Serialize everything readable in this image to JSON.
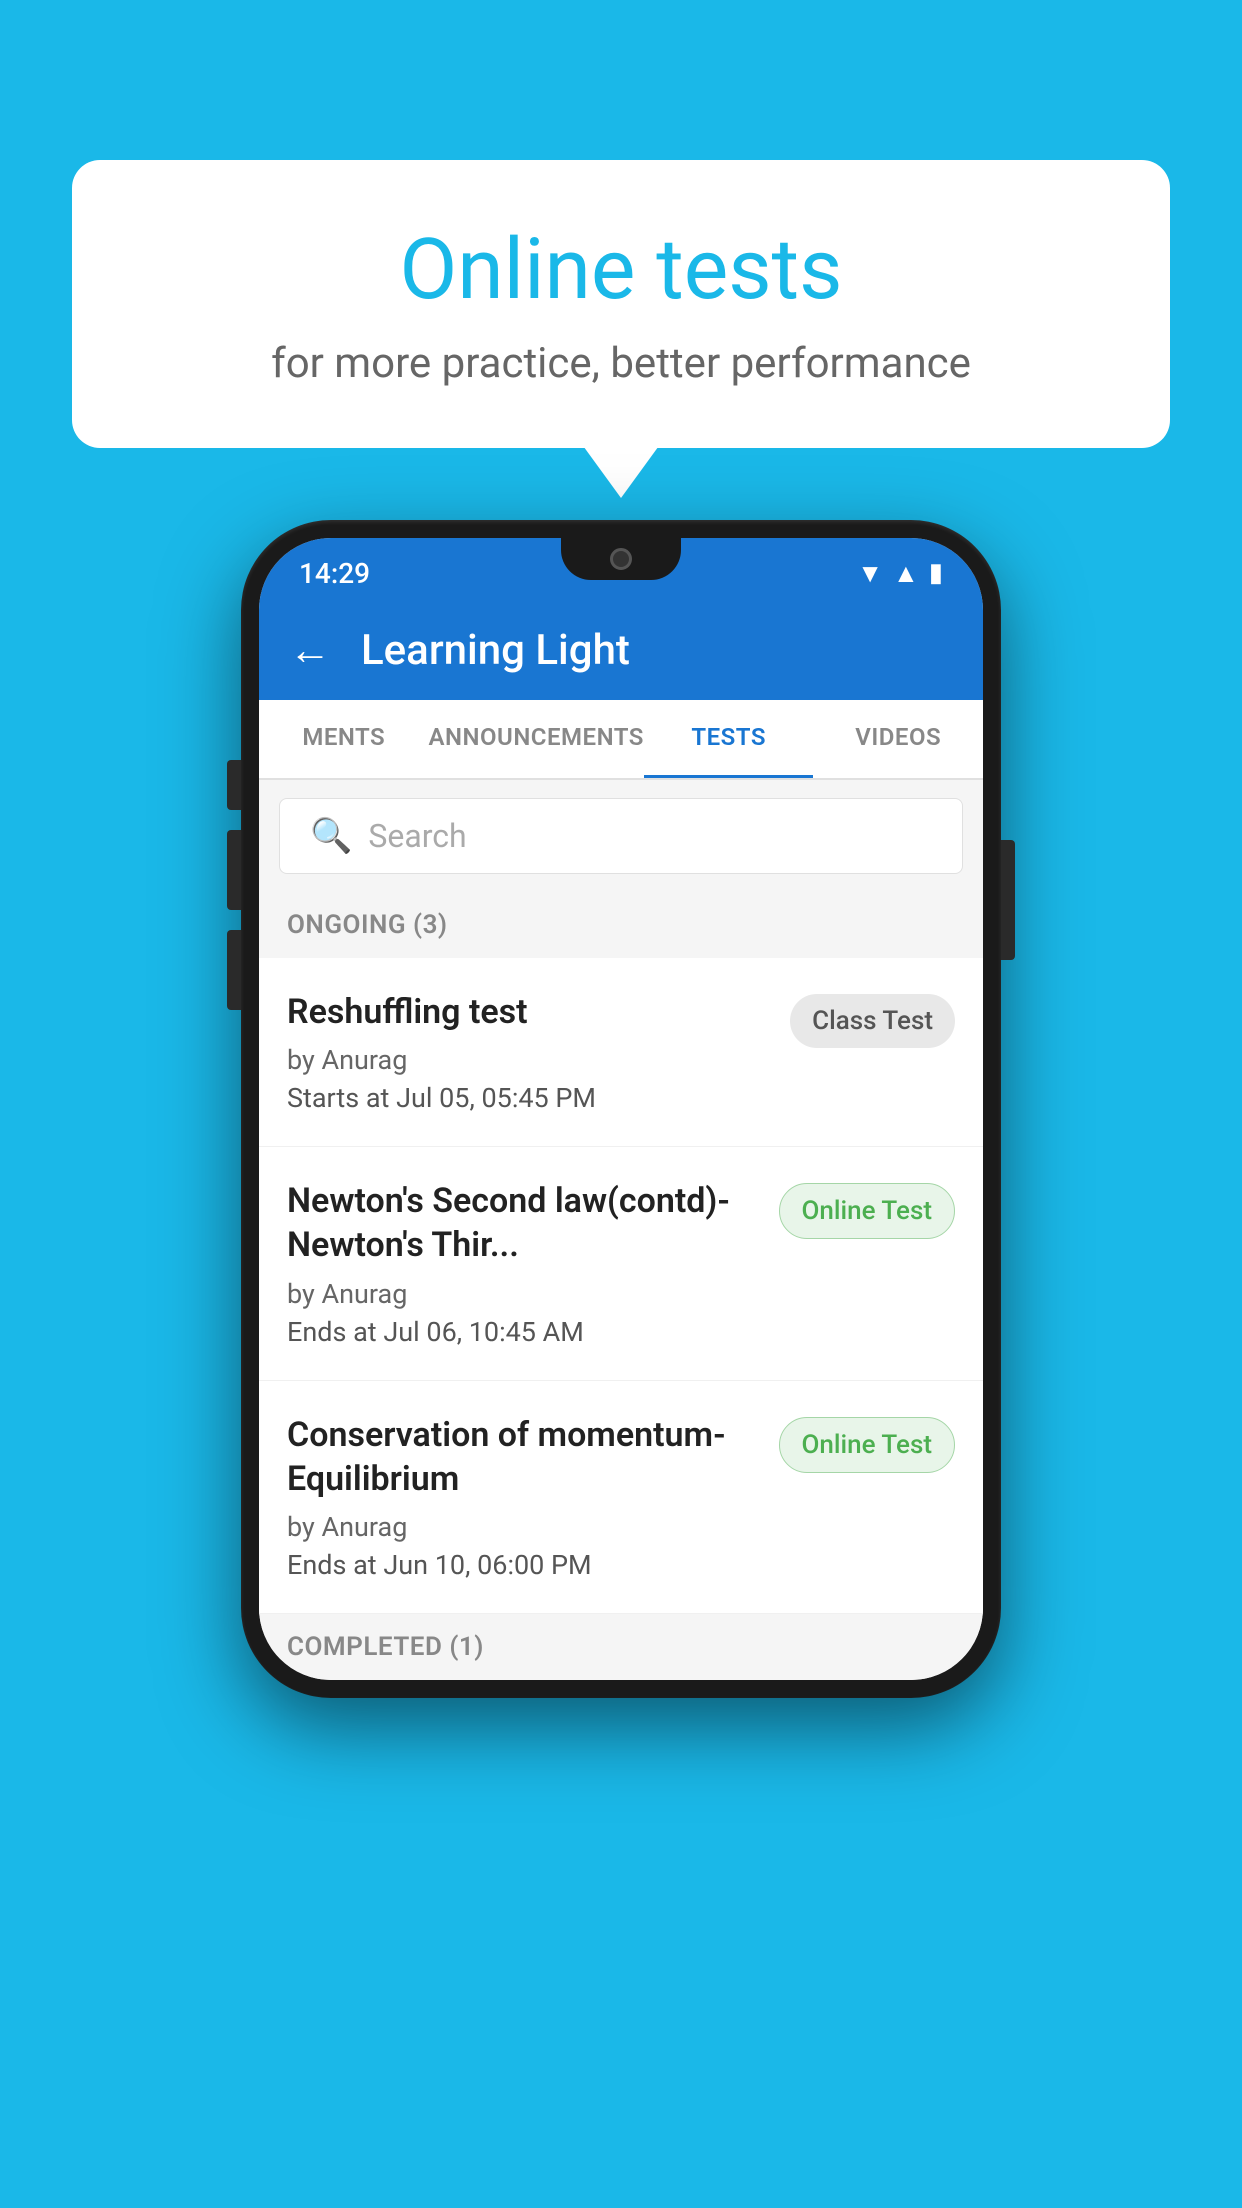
{
  "background": {
    "color": "#1ab8e8"
  },
  "bubble": {
    "title": "Online tests",
    "subtitle": "for more practice, better performance"
  },
  "phone": {
    "status_bar": {
      "time": "14:29",
      "icons": [
        "wifi",
        "signal",
        "battery"
      ]
    },
    "app_bar": {
      "back_label": "←",
      "title": "Learning Light"
    },
    "tabs": [
      {
        "label": "MENTS",
        "active": false
      },
      {
        "label": "ANNOUNCEMENTS",
        "active": false
      },
      {
        "label": "TESTS",
        "active": true
      },
      {
        "label": "VIDEOS",
        "active": false
      }
    ],
    "search": {
      "placeholder": "Search"
    },
    "ongoing_section": {
      "label": "ONGOING (3)"
    },
    "tests": [
      {
        "name": "Reshuffling test",
        "author": "by Anurag",
        "time_label": "Starts at",
        "time": "Jul 05, 05:45 PM",
        "badge": "Class Test",
        "badge_type": "class"
      },
      {
        "name": "Newton's Second law(contd)-Newton's Thir...",
        "author": "by Anurag",
        "time_label": "Ends at",
        "time": "Jul 06, 10:45 AM",
        "badge": "Online Test",
        "badge_type": "online"
      },
      {
        "name": "Conservation of momentum-Equilibrium",
        "author": "by Anurag",
        "time_label": "Ends at",
        "time": "Jun 10, 06:00 PM",
        "badge": "Online Test",
        "badge_type": "online"
      }
    ],
    "completed_section": {
      "label": "COMPLETED (1)"
    }
  }
}
